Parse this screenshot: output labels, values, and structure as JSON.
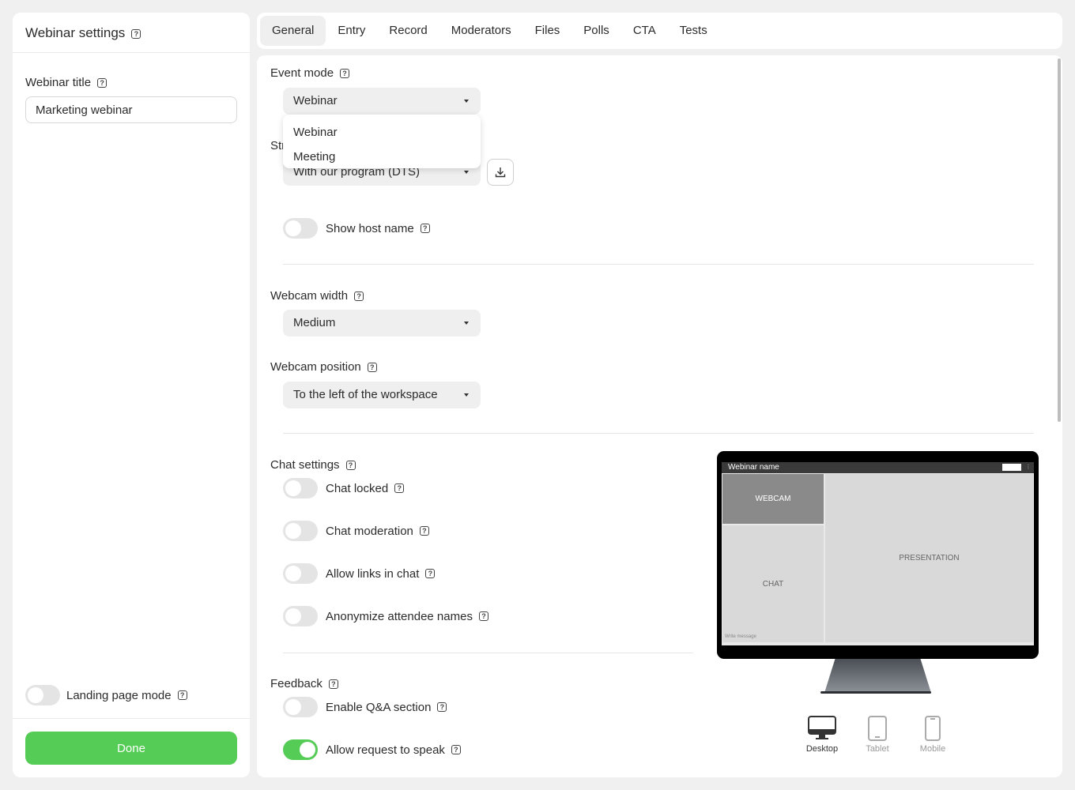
{
  "left": {
    "header": "Webinar settings",
    "title_label": "Webinar title",
    "title_value": "Marketing webinar",
    "landing_label": "Landing page mode",
    "done_label": "Done"
  },
  "tabs": [
    "General",
    "Entry",
    "Record",
    "Moderators",
    "Files",
    "Polls",
    "CTA",
    "Tests"
  ],
  "general": {
    "event_mode_label": "Event mode",
    "event_mode_value": "Webinar",
    "event_mode_options": [
      "Webinar",
      "Meeting"
    ],
    "stream_label_visible": "Str",
    "stream_value": "With our program (DTS)",
    "show_host_label": "Show host name",
    "webcam_width_label": "Webcam width",
    "webcam_width_value": "Medium",
    "webcam_position_label": "Webcam position",
    "webcam_position_value": "To the left of the workspace",
    "chat_settings_label": "Chat settings",
    "chat_locked": "Chat locked",
    "chat_moderation": "Chat moderation",
    "allow_links": "Allow links in chat",
    "anonymize": "Anonymize attendee names",
    "feedback_label": "Feedback",
    "enable_qa": "Enable Q&A section",
    "request_speak": "Allow request to speak"
  },
  "preview": {
    "webinar_name": "Webinar name",
    "webcam": "WEBCAM",
    "chat": "CHAT",
    "presentation": "PRESENTATION",
    "write_message": "Write message",
    "devices": [
      "Desktop",
      "Tablet",
      "Mobile"
    ]
  },
  "colors": {
    "accent": "#55cc55",
    "background": "#f0f0f0"
  },
  "icons": [
    "help-icon",
    "caret-down-icon",
    "download-icon",
    "desktop-icon",
    "tablet-icon",
    "mobile-icon"
  ]
}
